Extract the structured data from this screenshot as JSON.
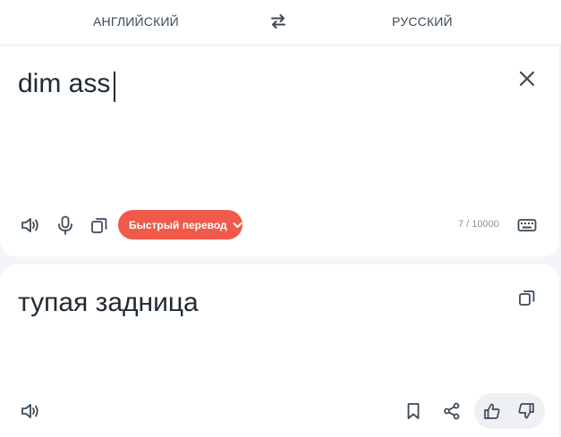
{
  "langbar": {
    "source_lang": "АНГЛИЙСКИЙ",
    "target_lang": "РУССКИЙ",
    "swap_icon": "swap-arrows-icon"
  },
  "source": {
    "text": "dim ass",
    "fast_translate_label": "Быстрый перевод",
    "counter": "7 / 10000",
    "icons": [
      "speaker-icon",
      "microphone-icon",
      "copy-icon",
      "chevron-down-icon",
      "keyboard-icon",
      "close-icon"
    ]
  },
  "target": {
    "text": "тупая задница",
    "icons": [
      "copy-icon",
      "speaker-icon",
      "bookmark-icon",
      "share-icon",
      "thumbs-up-icon",
      "thumbs-down-icon"
    ]
  },
  "colors": {
    "accent": "#f05a4a",
    "text": "#1f2a33",
    "background": "#f4f5f8",
    "card": "#ffffff"
  }
}
